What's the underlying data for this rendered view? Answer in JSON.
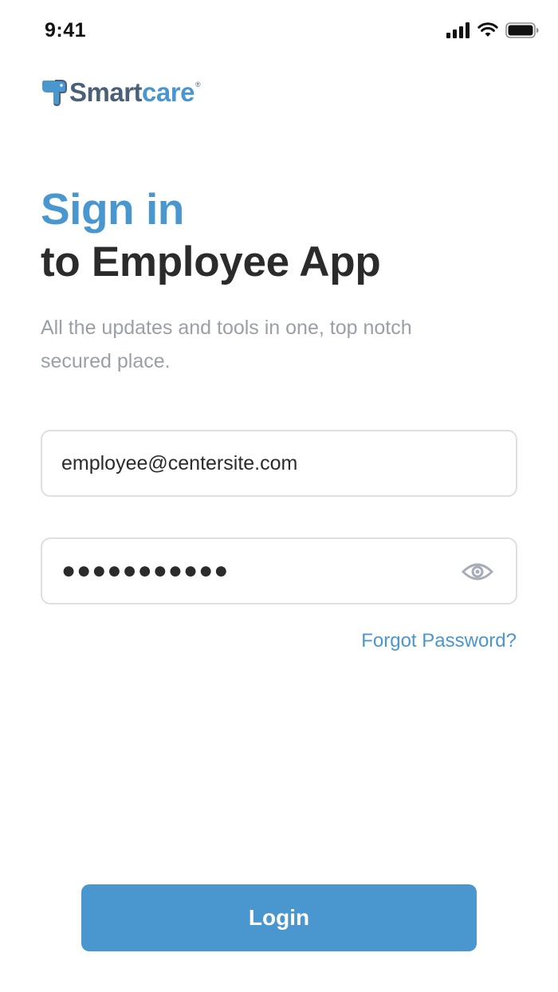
{
  "status_bar": {
    "time": "9:41",
    "icons": [
      "cellular-signal-icon",
      "wifi-icon",
      "battery-icon"
    ]
  },
  "logo": {
    "name_part1": "Smart",
    "name_part2": "care",
    "registered": "®",
    "icon": "elephant-logo-icon"
  },
  "heading": {
    "accent": "Sign in",
    "main": "to Employee App"
  },
  "subtitle": "All the updates and tools in one, top notch secured place.",
  "form": {
    "email_value": "employee@centersite.com",
    "password_masked": "●●●●●●●●●●●",
    "show_password_icon": "eye-icon",
    "forgot_password": "Forgot Password?"
  },
  "login_button": "Login",
  "colors": {
    "accent": "#4a97d0",
    "heading": "#2b2b2b",
    "subtitle": "#9aa0a8",
    "logo_dark": "#4a5f78",
    "field_border": "#dcdfe3"
  }
}
